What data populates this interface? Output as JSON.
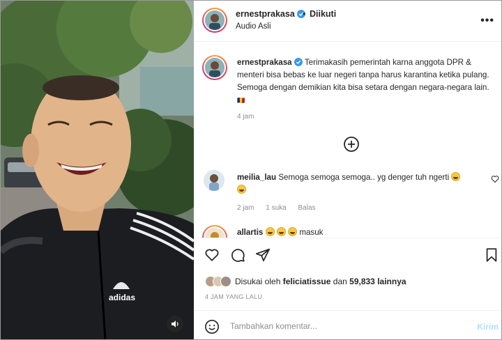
{
  "header": {
    "username": "ernestprakasa",
    "separator": "•",
    "follow_status": "Diikuti",
    "audio": "Audio Asli",
    "more": "•••"
  },
  "caption": {
    "username": "ernestprakasa",
    "text": "Terimakasih pemerintah karna anggota DPR & menteri bisa bebas ke luar negeri tanpa harus karantina ketika pulang. Semoga dengan demikian kita bisa setara dengan negara-negara lain.",
    "tag": "🇹🇩",
    "time": "4 jam"
  },
  "comments": [
    {
      "username": "meilia_lau",
      "text": "Semoga semoga semoga.. yg denger tuh ngerti",
      "time": "2 jam",
      "likes": "1 suka",
      "reply": "Balas"
    },
    {
      "username": "allartis",
      "text": "masuk"
    }
  ],
  "likes": {
    "prefix": "Disukai oleh",
    "user": "feliciatissue",
    "middle": "dan",
    "count": "59,833",
    "suffix": "lainnya"
  },
  "post_time": "4 JAM YANG LALU",
  "comment_input": {
    "placeholder": "Tambahkan komentar...",
    "post_label": "Kirim"
  },
  "media": {
    "jacket_brand": "adidas"
  },
  "colors": {
    "verified": "#3897f0",
    "post_button_disabled": "#b2dffc",
    "muted_text": "#8e8e8e"
  }
}
